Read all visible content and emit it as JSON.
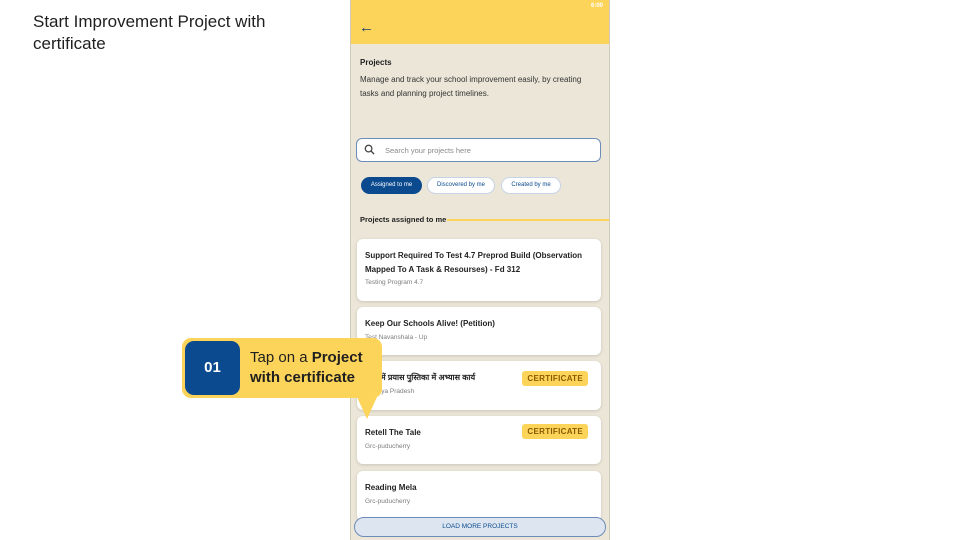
{
  "slide": {
    "title": "Start Improvement Project with certificate"
  },
  "status_bar": {
    "time": "6:00"
  },
  "header": {
    "title": "Projects",
    "description": "Manage and track your school improvement easily, by creating tasks and planning project timelines."
  },
  "search": {
    "placeholder": "Search your projects here"
  },
  "filters": [
    {
      "label": "Assigned to me",
      "active": true
    },
    {
      "label": "Discovered by me",
      "active": false
    },
    {
      "label": "Created by me",
      "active": false
    }
  ],
  "section": {
    "label": "Projects assigned to me"
  },
  "projects": [
    {
      "title_line1": "Support Required To Test 4.7 Preprod Build (Observation",
      "title_line2": "Mapped To A Task & Resourses) - Fd 312",
      "subtitle": "Testing Program 4.7",
      "badge": ""
    },
    {
      "title_line1": "Keep Our Schools Alive! (Petition)",
      "title_line2": "",
      "subtitle": "Test Navanshala - Up",
      "badge": ""
    },
    {
      "title_line1": "आश में प्रयास पुस्तिका में अभ्यास कार्य",
      "title_line2": "",
      "subtitle": "Madhya Pradesh",
      "badge": "CERTIFICATE"
    },
    {
      "title_line1": "Retell The Tale",
      "title_line2": "",
      "subtitle": "Grc-puducherry",
      "badge": "CERTIFICATE"
    },
    {
      "title_line1": "Reading Mela",
      "title_line2": "",
      "subtitle": "Grc-puducherry",
      "badge": ""
    }
  ],
  "load_more": {
    "label": "LOAD MORE PROJECTS"
  },
  "callout": {
    "number": "01",
    "text_prefix": "Tap on a ",
    "text_bold": "Project with certificate"
  },
  "colors": {
    "accent_yellow": "#fdd45a",
    "primary_blue": "#0b4a8f",
    "background": "#ebe6d8"
  }
}
